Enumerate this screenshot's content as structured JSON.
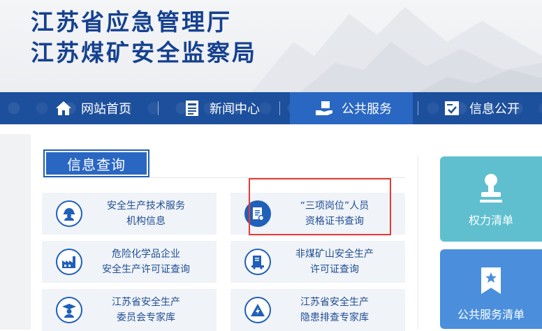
{
  "header": {
    "title_line1": "江苏省应急管理厅",
    "title_line2": "江苏煤矿安全监察局"
  },
  "nav": {
    "items": [
      {
        "label": "网站首页",
        "icon": "home-icon"
      },
      {
        "label": "新闻中心",
        "icon": "news-icon"
      },
      {
        "label": "公共服务",
        "icon": "service-hand-icon",
        "active": true
      },
      {
        "label": "信息公开",
        "icon": "info-check-icon"
      }
    ]
  },
  "section": {
    "title": "信息查询"
  },
  "cards": [
    {
      "line1": "安全生产技术服务",
      "line2": "机构信息",
      "icon": "worker-helmet-icon"
    },
    {
      "line1": "“三项岗位”人员",
      "line2": "资格证书查询",
      "icon": "certificate-icon",
      "highlighted": true
    },
    {
      "line1": "危险化学品企业",
      "line2": "安全生产许可证查询",
      "icon": "factory-icon"
    },
    {
      "line1": "非煤矿山安全生产",
      "line2": "许可证查询",
      "icon": "mine-cart-icon"
    },
    {
      "line1": "江苏省安全生产",
      "line2": "委员会专家库",
      "icon": "expert-graduate-icon"
    },
    {
      "line1": "江苏省安全生产",
      "line2": "隐患排查专家库",
      "icon": "hazard-warning-icon"
    }
  ],
  "side_buttons": [
    {
      "label": "权力清单",
      "icon": "seal-stamp-icon",
      "color": "#5fbfcf"
    },
    {
      "label": "公共服务清单",
      "icon": "bookmark-star-icon",
      "color": "#4b8fdc"
    }
  ],
  "colors": {
    "brand_blue": "#15418f",
    "nav_bg": "#1c4f9c",
    "nav_active": "#2a67c2",
    "highlight_red": "#e53935"
  }
}
